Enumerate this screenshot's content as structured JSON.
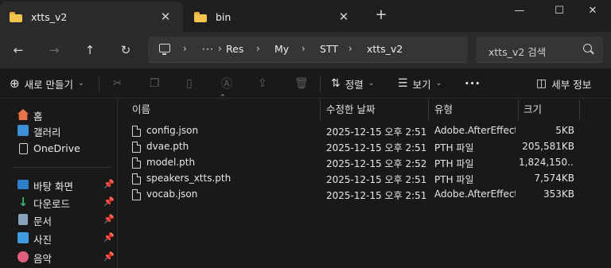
{
  "tabs": [
    {
      "label": "xtts_v2",
      "active": true
    },
    {
      "label": "bin",
      "active": false
    }
  ],
  "window_controls": {
    "minimize": "—",
    "maximize": "☐",
    "close": "✕"
  },
  "nav": {
    "back": "←",
    "forward": "→",
    "up": "↑",
    "refresh": "↻"
  },
  "breadcrumb": {
    "overflow": "···",
    "items": [
      "Res",
      "My",
      "STT",
      "xtts_v2"
    ]
  },
  "search": {
    "placeholder": "xtts_v2 검색"
  },
  "commandbar": {
    "new_label": "새로 만들기",
    "sort_label": "정렬",
    "view_label": "보기",
    "more_label": "···",
    "details_label": "세부 정보"
  },
  "sidebar": {
    "top": [
      {
        "label": "홈",
        "icon": "home-icon"
      },
      {
        "label": "갤러리",
        "icon": "gallery-icon"
      },
      {
        "label": "OneDrive",
        "icon": "onedrive-icon"
      }
    ],
    "pinned": [
      {
        "label": "바탕 화면",
        "icon": "desktop-icon"
      },
      {
        "label": "다운로드",
        "icon": "download-icon"
      },
      {
        "label": "문서",
        "icon": "documents-icon"
      },
      {
        "label": "사진",
        "icon": "pictures-icon"
      },
      {
        "label": "음악",
        "icon": "music-icon"
      }
    ]
  },
  "columns": [
    "이름",
    "수정한 날짜",
    "유형",
    "크기"
  ],
  "files": [
    {
      "name": "config.json",
      "modified": "2025-12-15 오후 2:51",
      "type": "Adobe.AfterEffect...",
      "size": "5KB"
    },
    {
      "name": "dvae.pth",
      "modified": "2025-12-15 오후 2:51",
      "type": "PTH 파일",
      "size": "205,581KB"
    },
    {
      "name": "model.pth",
      "modified": "2025-12-15 오후 2:52",
      "type": "PTH 파일",
      "size": "1,824,150..."
    },
    {
      "name": "speakers_xtts.pth",
      "modified": "2025-12-15 오후 2:51",
      "type": "PTH 파일",
      "size": "7,574KB"
    },
    {
      "name": "vocab.json",
      "modified": "2025-12-15 오후 2:51",
      "type": "Adobe.AfterEffect...",
      "size": "353KB"
    }
  ]
}
